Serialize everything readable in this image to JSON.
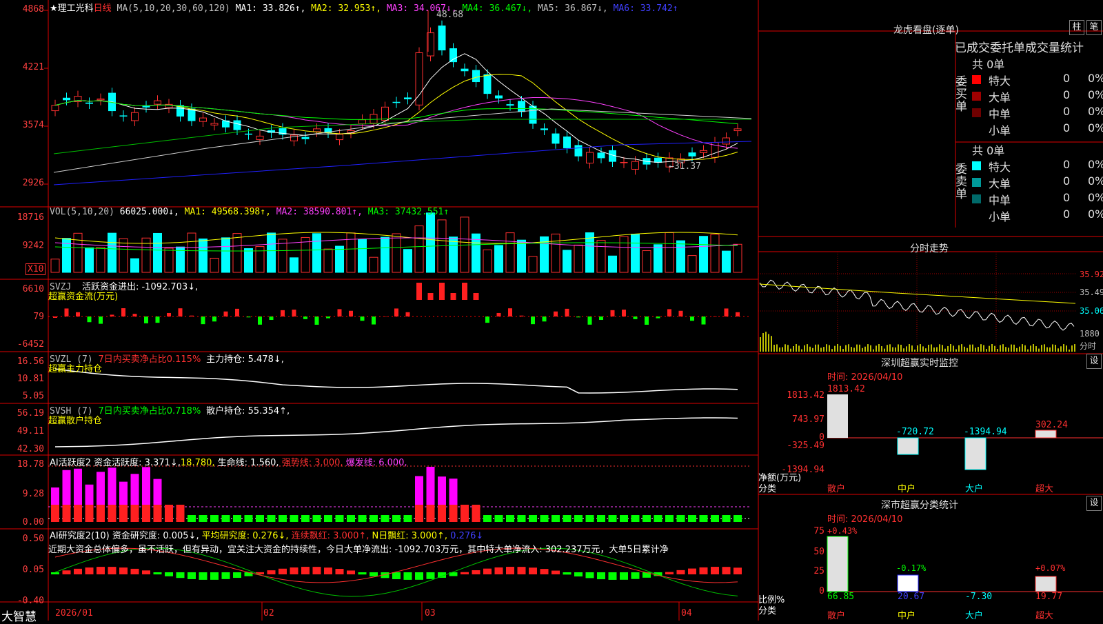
{
  "stock": {
    "name": "★理工光科",
    "period": "日线"
  },
  "main_panel": {
    "y_labels": [
      "4868",
      "4221",
      "3574",
      "2926"
    ],
    "legend": {
      "ma": "MA(5,10,20,30,60,120)",
      "ma1": "MA1: 33.826↑,",
      "ma2": "MA2: 32.953↑,",
      "ma3": "MA3: 34.067↓,",
      "ma4": "MA4: 36.467↓,",
      "ma5": "MA5: 36.867↓,",
      "ma6": "MA6: 33.742↑"
    },
    "high_label": "48.68",
    "low_label": "←31.37"
  },
  "vol_panel": {
    "y_labels": [
      "18716",
      "9242",
      "X10"
    ],
    "legend": {
      "name": "VOL(5,10,20)",
      "v": "66025.000↓,",
      "ma1": "MA1: 49568.398↑,",
      "ma2": "MA2: 38590.801↑,",
      "ma3": "MA3: 37432.551↑"
    }
  },
  "svzj_panel": {
    "y_labels": [
      "6610",
      "79",
      "-6452"
    ],
    "legend": {
      "name": "SVZJ",
      "text": "活跃资金进出: -1092.703↓,",
      "sub": "超赢资金流(万元)"
    }
  },
  "svzl_panel": {
    "y_labels": [
      "16.56",
      "10.81",
      "5.05"
    ],
    "legend": {
      "name": "SVZL (7)",
      "pct": "7日内买卖净占比0.115%",
      "text": "主力持仓: 5.478↓,",
      "sub": "超赢主力持仓"
    }
  },
  "svsh_panel": {
    "y_labels": [
      "56.19",
      "49.11",
      "42.30"
    ],
    "legend": {
      "name": "SVSH (7)",
      "pct": "7日内买卖净占比0.718%",
      "text": "散户持仓: 55.354↑,",
      "sub": "超赢散户持仓"
    }
  },
  "ai1_panel": {
    "y_labels": [
      "18.78",
      "9.28",
      "0.00"
    ],
    "legend": {
      "name": "AI活跃度2",
      "a": "资金活跃度: 3.371↓,",
      "b": "18.780,",
      "c": "生命线: 1.560,",
      "d": "强势线: 3.000,",
      "e": "爆发线: 6.000,"
    }
  },
  "ai2_panel": {
    "y_labels": [
      "0.50",
      "0.05",
      "-0.40"
    ],
    "legend": {
      "name": "AI研究度2(10)",
      "a": "资金研究度: 0.005↓,",
      "b": "平均研究度: 0.276↓,",
      "c": "连续飘红: 3.000↑,",
      "d": "N日飘红: 3.000↑,",
      "e": "0.276↓"
    },
    "comment": "近期大资金总体偏多，虽不活跃，但有异动，宜关注大资金的持续性，今日大单净流出: -1092.703万元，其中特大单净流入: 302.237万元，大单5日累计净"
  },
  "time_axis": {
    "brand": "大智慧",
    "labels": [
      "2026/01",
      "02",
      "03",
      "04"
    ]
  },
  "longhu": {
    "title": "龙虎看盘(逐单)",
    "btn1": "柱",
    "btn2": "笔",
    "subtitle": "已成交委托单成交量统计",
    "buy_side": "委买单",
    "sell_side": "委卖单",
    "buy_total": "共 0单",
    "sell_total": "共 0单",
    "buy_rows": [
      {
        "label": "特大",
        "count": "0",
        "pct": "0%"
      },
      {
        "label": "大单",
        "count": "0",
        "pct": "0%"
      },
      {
        "label": "中单",
        "count": "0",
        "pct": "0%"
      },
      {
        "label": "小单",
        "count": "0",
        "pct": "0%"
      }
    ],
    "sell_rows": [
      {
        "label": "特大",
        "count": "0",
        "pct": "0%"
      },
      {
        "label": "大单",
        "count": "0",
        "pct": "0%"
      },
      {
        "label": "中单",
        "count": "0",
        "pct": "0%"
      },
      {
        "label": "小单",
        "count": "0",
        "pct": "0%"
      }
    ]
  },
  "intraday": {
    "title": "分时走势",
    "y_labels": [
      "35.92",
      "35.49",
      "35.06"
    ],
    "vol_label": "1880",
    "unit": "分时"
  },
  "sz_monitor": {
    "title": "深圳超赢实时监控",
    "btn": "设",
    "time": "时间: 2026/04/10",
    "y_labels": [
      "1813.42",
      "743.97",
      "0",
      "-325.49",
      "-1394.94"
    ],
    "y_unit": "净额(万元)",
    "x_unit": "分类",
    "bars": [
      {
        "cat": "散户",
        "value": "1813.42"
      },
      {
        "cat": "中户",
        "value": "-720.72"
      },
      {
        "cat": "大户",
        "value": "-1394.94"
      },
      {
        "cat": "超大",
        "value": "302.24"
      }
    ]
  },
  "sz_class": {
    "title": "深市超赢分类统计",
    "btn": "设",
    "time": "时间: 2026/04/10",
    "y_labels": [
      "75",
      "50",
      "25",
      "0"
    ],
    "y_unit": "比例%",
    "x_unit": "分类",
    "bars": [
      {
        "cat": "散户",
        "top": "+0.43%",
        "value": "66.85"
      },
      {
        "cat": "中户",
        "top": "-0.17%",
        "value": "20.67"
      },
      {
        "cat": "大户",
        "top": "",
        "value": "-7.30"
      },
      {
        "cat": "超大",
        "top": "+0.07%",
        "value": "19.77"
      }
    ]
  }
}
